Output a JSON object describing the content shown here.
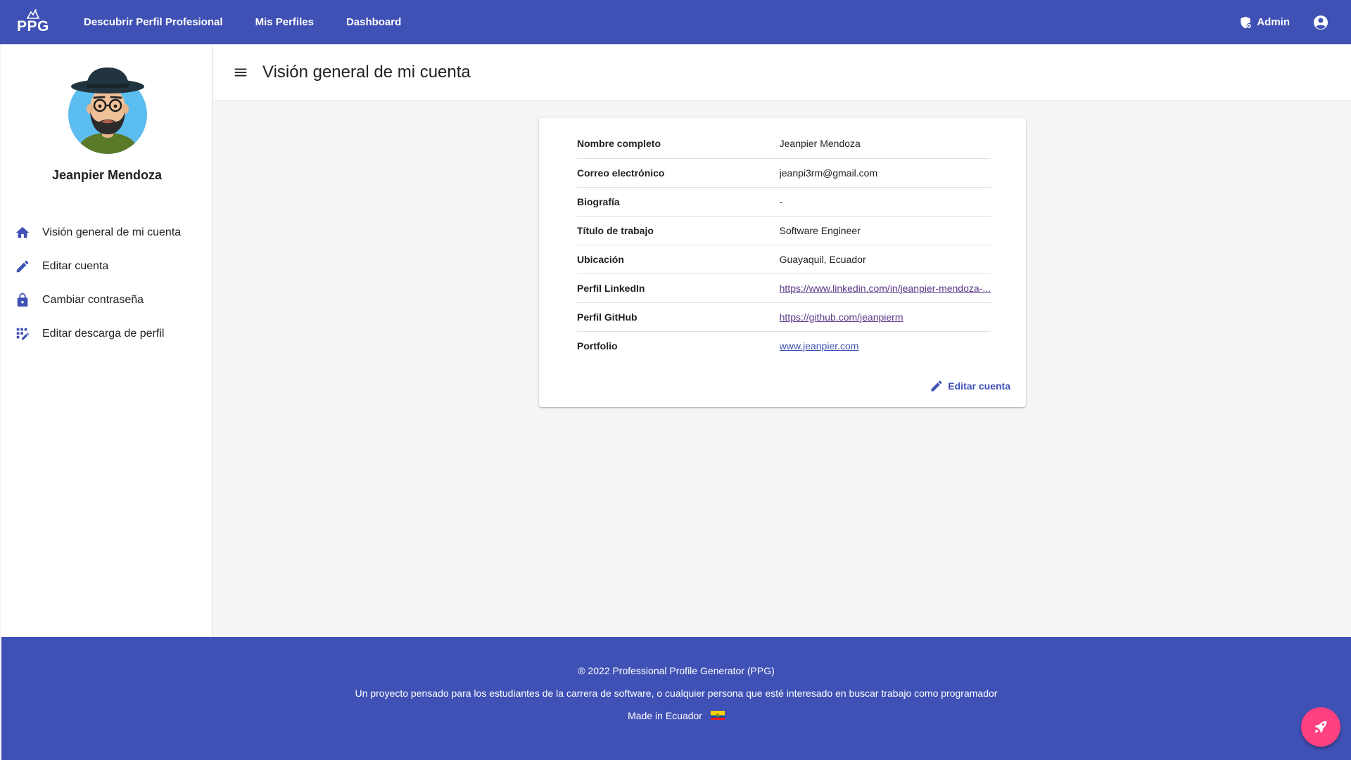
{
  "app": {
    "logo_text": "PPG",
    "brand_color": "#3f51b5",
    "accent_color": "#ff4081"
  },
  "topbar": {
    "nav": [
      {
        "label": "Descubrir Perfil Profesional"
      },
      {
        "label": "Mis Perfiles"
      },
      {
        "label": "Dashboard"
      }
    ],
    "admin_label": "Admin",
    "admin_icon": "admin-shield-icon",
    "account_icon": "account-circle-icon"
  },
  "sidebar": {
    "user_name": "Jeanpier Mendoza",
    "menu": [
      {
        "label": "Visión general de mi cuenta",
        "icon": "home-icon"
      },
      {
        "label": "Editar cuenta",
        "icon": "pencil-icon"
      },
      {
        "label": "Cambiar contraseña",
        "icon": "lock-icon"
      },
      {
        "label": "Editar descarga de perfil",
        "icon": "grid-edit-icon"
      }
    ]
  },
  "main": {
    "title": "Visión general de mi cuenta",
    "rows": [
      {
        "label": "Nombre completo",
        "value": "Jeanpier Mendoza"
      },
      {
        "label": "Correo electrónico",
        "value": "jeanpi3rm@gmail.com"
      },
      {
        "label": "Biografía",
        "value": "-"
      },
      {
        "label": "Título de trabajo",
        "value": "Software Engineer"
      },
      {
        "label": "Ubicación",
        "value": "Guayaquil, Ecuador"
      },
      {
        "label": "Perfil LinkedIn",
        "value": "https://www.linkedin.com/in/jeanpier-mendoza-..."
      },
      {
        "label": "Perfil GitHub",
        "value": "https://github.com/jeanpierm"
      },
      {
        "label": "Portfolio",
        "value": "www.jeanpier.com"
      }
    ],
    "edit_label": "Editar cuenta"
  },
  "footer": {
    "copyright": "® 2022 Professional Profile Generator (PPG)",
    "description": "Un proyecto pensado para los estudiantes de la carrera de software, o cualquier persona que esté interesado en buscar trabajo como programador",
    "made_in": "Made in Ecuador"
  }
}
